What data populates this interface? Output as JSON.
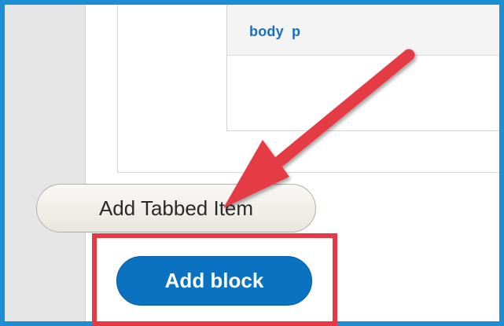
{
  "breadcrumb": {
    "items": [
      "body",
      "p"
    ]
  },
  "buttons": {
    "add_tabbed_item": "Add Tabbed Item",
    "add_block": "Add block"
  },
  "colors": {
    "frame": "#1b8fd2",
    "annotation": "#e53a44",
    "primary": "#0a72c1",
    "link": "#1a6fb8"
  }
}
